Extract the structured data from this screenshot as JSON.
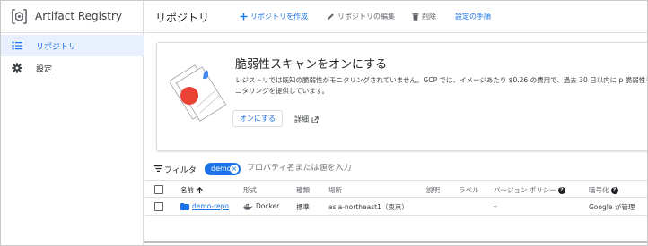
{
  "app": {
    "title": "Artifact Registry"
  },
  "sidebar": {
    "items": [
      {
        "label": "リポジトリ",
        "icon": "list-icon",
        "active": true
      },
      {
        "label": "設定",
        "icon": "gear-icon",
        "active": false
      }
    ]
  },
  "header": {
    "title": "リポジトリ",
    "actions": [
      {
        "label": "リポジトリを作成",
        "icon": "plus-icon",
        "enabled": true
      },
      {
        "label": "リポジトリの編集",
        "icon": "pencil-icon",
        "enabled": false
      },
      {
        "label": "削除",
        "icon": "trash-icon",
        "enabled": false
      },
      {
        "label": "設定の手順",
        "icon": "",
        "enabled": true
      }
    ]
  },
  "banner": {
    "title": "脆弱性スキャンをオンにする",
    "description": "レジストリでは既知の脆弱性がモニタリングされていません。GCP では、イメージあたり $0.26 の費用で、過去 30 日以内に p 脆弱性モニタリングを提供しています。",
    "primary_button": "オンにする",
    "details_link": "詳細",
    "details_icon": "external-link-icon"
  },
  "filter": {
    "label": "フィルタ",
    "icon": "filter-icon",
    "chip": "demo",
    "placeholder": "プロパティ名または値を入力"
  },
  "table": {
    "columns": {
      "name": "名前",
      "format": "形式",
      "type": "種類",
      "location": "場所",
      "description": "説明",
      "labels": "ラベル",
      "version_policy": "バージョン ポリシー",
      "encryption": "暗号化"
    },
    "sort": "ascending",
    "rows": [
      {
        "name": "demo-repo",
        "format": "Docker",
        "type": "標準",
        "location": "asia-northeast1（東京）",
        "description": "",
        "labels": "",
        "version_policy": "–",
        "encryption": "Google が管理"
      }
    ]
  },
  "colors": {
    "accent": "#1a73e8",
    "active_bg": "#e8f0fe",
    "illustration_red": "#ea4335",
    "illustration_blue": "#4285f4"
  }
}
